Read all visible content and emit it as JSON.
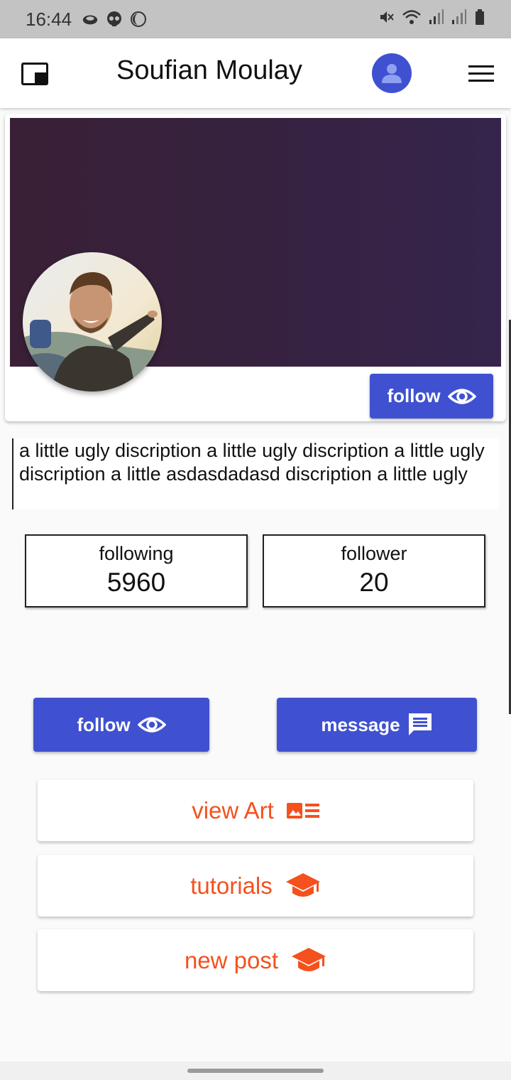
{
  "status_bar": {
    "time": "16:44",
    "icons": [
      "cloud-icon",
      "skull-icon",
      "moon-icon",
      "mute-icon",
      "wifi-icon",
      "signal-icon",
      "signal-icon",
      "battery-icon"
    ]
  },
  "app_bar": {
    "title": "Soufian Moulay",
    "accent_color": "#3f51d1"
  },
  "profile": {
    "cover_colors": [
      "#3a2036",
      "#35244c"
    ],
    "follow_label": "follow"
  },
  "description": {
    "text": "a little ugly discription a little ugly discription a little ugly discription a little asdasdadasd discription a little ugly"
  },
  "stats": {
    "following_label": "following",
    "following_value": "5960",
    "follower_label": "follower",
    "follower_value": "20"
  },
  "actions": {
    "follow_label": "follow",
    "message_label": "message"
  },
  "menu": {
    "items": [
      {
        "label": "view Art",
        "icon": "gallery-icon"
      },
      {
        "label": "tutorials",
        "icon": "graduation-cap-icon"
      },
      {
        "label": "new post",
        "icon": "graduation-cap-icon"
      }
    ],
    "color": "#f4511e"
  }
}
